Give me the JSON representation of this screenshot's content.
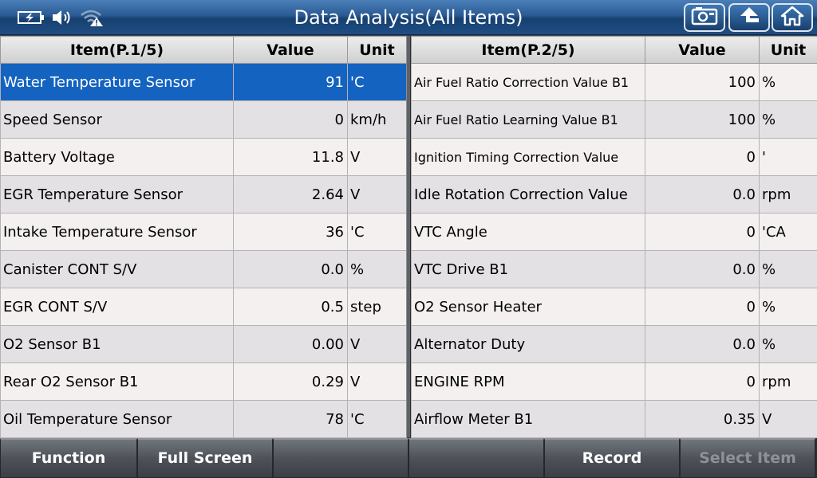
{
  "header": {
    "title": "Data Analysis(All Items)"
  },
  "left_table": {
    "headers": {
      "item": "Item(P.1/5)",
      "value": "Value",
      "unit": "Unit"
    },
    "rows": [
      {
        "item": "Water Temperature Sensor",
        "value": "91",
        "unit": "'C"
      },
      {
        "item": "Speed Sensor",
        "value": "0",
        "unit": "km/h"
      },
      {
        "item": "Battery Voltage",
        "value": "11.8",
        "unit": "V"
      },
      {
        "item": "EGR Temperature Sensor",
        "value": "2.64",
        "unit": "V"
      },
      {
        "item": "Intake Temperature Sensor",
        "value": "36",
        "unit": "'C"
      },
      {
        "item": "Canister CONT S/V",
        "value": "0.0",
        "unit": "%"
      },
      {
        "item": "EGR CONT S/V",
        "value": "0.5",
        "unit": "step"
      },
      {
        "item": "O2 Sensor B1",
        "value": "0.00",
        "unit": "V"
      },
      {
        "item": "Rear O2 Sensor B1",
        "value": "0.29",
        "unit": "V"
      },
      {
        "item": "Oil Temperature Sensor",
        "value": "78",
        "unit": "'C"
      }
    ]
  },
  "right_table": {
    "headers": {
      "item": "Item(P.2/5)",
      "value": "Value",
      "unit": "Unit"
    },
    "rows": [
      {
        "item": "Air Fuel Ratio Correction Value B1",
        "value": "100",
        "unit": "%"
      },
      {
        "item": "Air Fuel Ratio Learning Value B1",
        "value": "100",
        "unit": "%"
      },
      {
        "item": "Ignition Timing Correction Value",
        "value": "0",
        "unit": "'"
      },
      {
        "item": "Idle Rotation Correction Value",
        "value": "0.0",
        "unit": "rpm"
      },
      {
        "item": "VTC Angle",
        "value": "0",
        "unit": "'CA"
      },
      {
        "item": "VTC Drive B1",
        "value": "0.0",
        "unit": "%"
      },
      {
        "item": "O2 Sensor Heater",
        "value": "0",
        "unit": "%"
      },
      {
        "item": "Alternator Duty",
        "value": "0.0",
        "unit": "%"
      },
      {
        "item": "ENGINE RPM",
        "value": "0",
        "unit": "rpm"
      },
      {
        "item": "Airflow Meter B1",
        "value": "0.35",
        "unit": "V"
      }
    ]
  },
  "toolbar": {
    "function_label": "Function",
    "fullscreen_label": "Full Screen",
    "blank1_label": "",
    "blank2_label": "",
    "record_label": "Record",
    "select_item_label": "Select Item"
  },
  "icons": {
    "battery": "battery-icon",
    "volume": "volume-icon",
    "wifi": "wifi-warning-icon",
    "camera": "camera-icon",
    "back": "back-arrow-icon",
    "home": "home-icon"
  },
  "colors": {
    "selected_row": "#1563c0",
    "title_bar": "#2a5a94"
  }
}
